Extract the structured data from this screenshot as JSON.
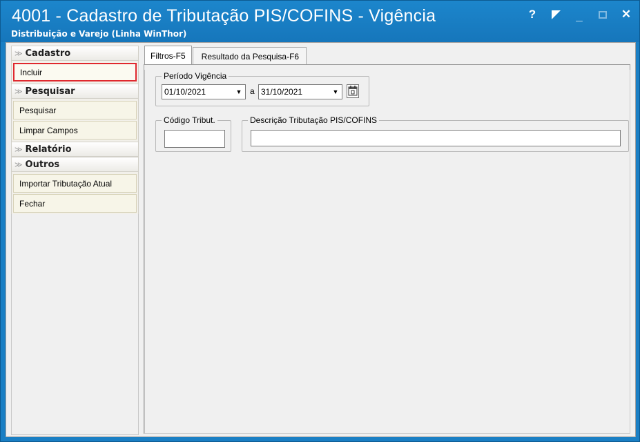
{
  "window": {
    "title": "4001 - Cadastro de Tributação PIS/COFINS - Vigência",
    "subtitle": "Distribuição e Varejo (Linha WinThor)",
    "controls": [
      "?",
      "restore",
      "_",
      "maximize",
      "✕"
    ]
  },
  "sidebar": {
    "groups": [
      {
        "label": "Cadastro",
        "items": [
          "Incluir"
        ]
      },
      {
        "label": "Pesquisar",
        "items": [
          "Pesquisar",
          "Limpar Campos"
        ]
      },
      {
        "label": "Relatório",
        "items": []
      },
      {
        "label": "Outros",
        "items": [
          "Importar Tributação Atual",
          "Fechar"
        ]
      }
    ],
    "selected_item": "Incluir",
    "selected_color": "#e0282e"
  },
  "tabs": [
    {
      "label": "Filtros-F5",
      "active": true
    },
    {
      "label": "Resultado da Pesquisa-F6",
      "active": false
    }
  ],
  "filters": {
    "periodo": {
      "label": "Período Vigência",
      "start": "01/10/2021",
      "between": "a",
      "end": "31/10/2021"
    },
    "codigo": {
      "label": "Código Tribut.",
      "value": ""
    },
    "descricao": {
      "label": "Descrição Tributação PIS/COFINS",
      "value": ""
    }
  },
  "colors": {
    "title_bar": "#1a7fc4",
    "accent_red": "#e0282e"
  }
}
